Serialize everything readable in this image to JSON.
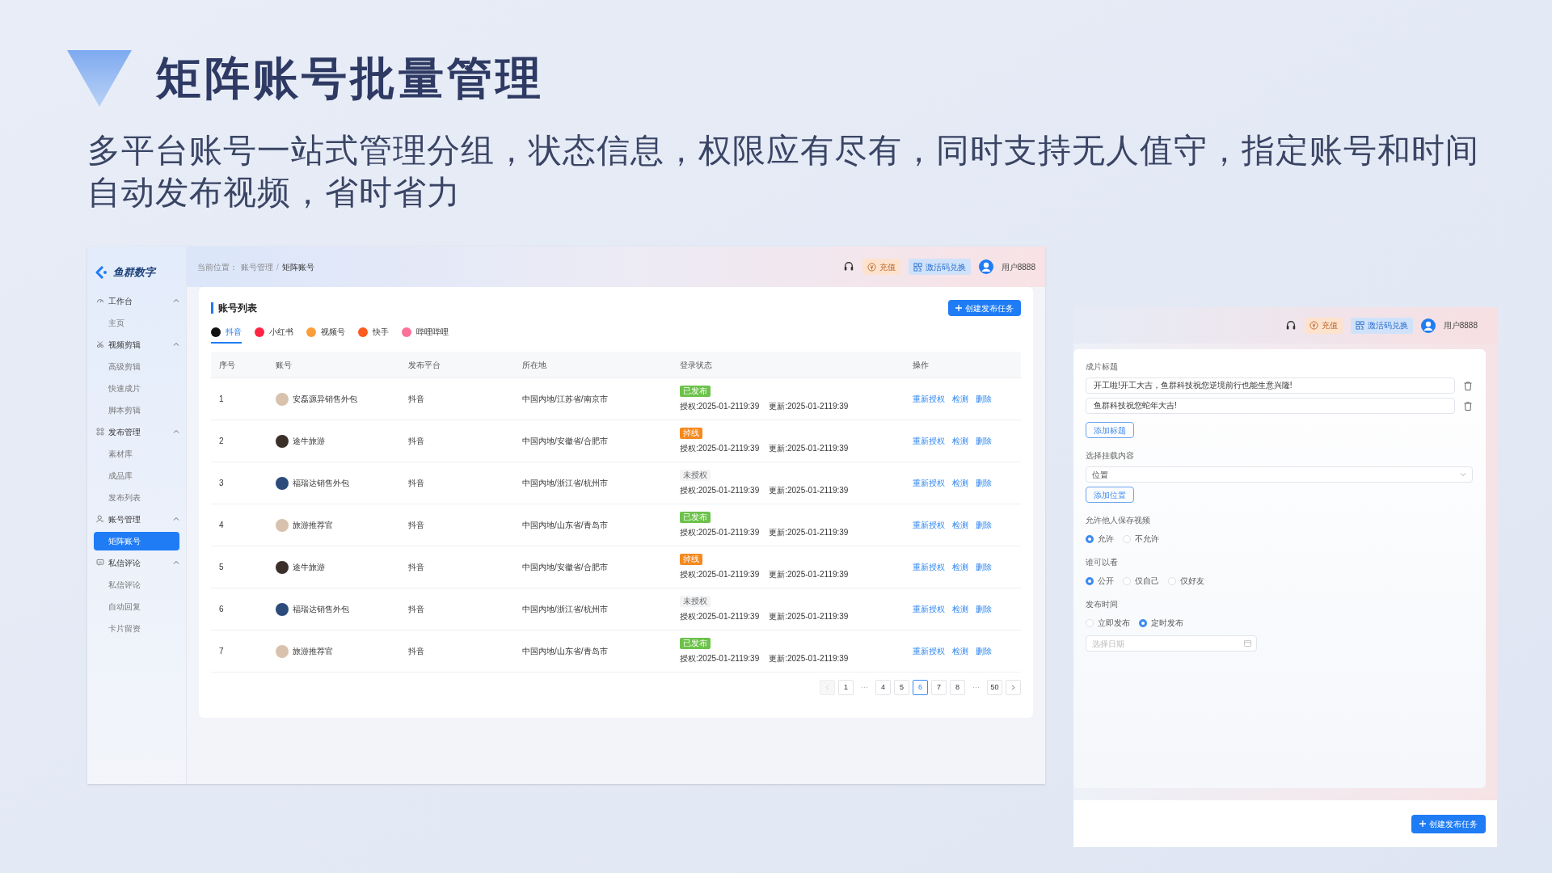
{
  "heading": {
    "title": "矩阵账号批量管理",
    "subtitle": "多平台账号一站式管理分组，状态信息，权限应有尽有，同时支持无人值守，指定账号和时间自动发布视频，省时省力"
  },
  "main_window": {
    "logo": "鱼群数字",
    "sidebar": [
      {
        "label": "工作台",
        "expanded": true,
        "children": [
          {
            "label": "主页",
            "selected": false
          }
        ]
      },
      {
        "label": "视频剪辑",
        "expanded": true,
        "children": [
          {
            "label": "高级剪辑",
            "selected": false
          },
          {
            "label": "快速成片",
            "selected": false
          },
          {
            "label": "脚本剪辑",
            "selected": false
          }
        ]
      },
      {
        "label": "发布管理",
        "expanded": true,
        "children": [
          {
            "label": "素材库",
            "selected": false
          },
          {
            "label": "成品库",
            "selected": false
          },
          {
            "label": "发布列表",
            "selected": false
          }
        ]
      },
      {
        "label": "账号管理",
        "expanded": true,
        "children": [
          {
            "label": "矩阵账号",
            "selected": true
          }
        ]
      },
      {
        "label": "私信评论",
        "expanded": true,
        "children": [
          {
            "label": "私信评论",
            "selected": false
          },
          {
            "label": "自动回复",
            "selected": false
          },
          {
            "label": "卡片留资",
            "selected": false
          }
        ]
      }
    ],
    "breadcrumb": {
      "prefix": "当前位置：",
      "items": [
        "账号管理",
        "矩阵账号"
      ],
      "separator": "/"
    },
    "header": {
      "recharge": "充值",
      "redeem": "激活码兑换",
      "user": "用户8888"
    },
    "card": {
      "title": "账号列表",
      "create_button": "创建发布任务",
      "tabs": [
        {
          "label": "抖音",
          "selected": true,
          "color": "#111111"
        },
        {
          "label": "小红书",
          "selected": false,
          "color": "#ff2442"
        },
        {
          "label": "视频号",
          "selected": false,
          "color": "#fa9d3b"
        },
        {
          "label": "快手",
          "selected": false,
          "color": "#ff5a1f"
        },
        {
          "label": "哔哩哔哩",
          "selected": false,
          "color": "#fb7299"
        }
      ],
      "table": {
        "columns": [
          "序号",
          "账号",
          "发布平台",
          "所在地",
          "登录状态",
          "操作"
        ],
        "rows": [
          {
            "index": "1",
            "account": "安磊源异销售外包",
            "platform": "抖音",
            "location": "中国内地/江苏省/南京市",
            "status": {
              "kind": "published",
              "label": "已发布"
            },
            "authorized": "授权:2025-01-2119:39",
            "updated": "更新:2025-01-2119:39",
            "actions": [
              "重新授权",
              "检测",
              "删除"
            ]
          },
          {
            "index": "2",
            "account": "途牛旅游",
            "platform": "抖音",
            "location": "中国内地/安徽省/合肥市",
            "status": {
              "kind": "offline",
              "label": "掉线"
            },
            "authorized": "授权:2025-01-2119:39",
            "updated": "更新:2025-01-2119:39",
            "actions": [
              "重新授权",
              "检测",
              "删除"
            ]
          },
          {
            "index": "3",
            "account": "福瑞达销售外包",
            "platform": "抖音",
            "location": "中国内地/浙江省/杭州市",
            "status": {
              "kind": "unauthorized",
              "label": "未授权"
            },
            "authorized": "授权:2025-01-2119:39",
            "updated": "更新:2025-01-2119:39",
            "actions": [
              "重新授权",
              "检测",
              "删除"
            ]
          },
          {
            "index": "4",
            "account": "旅游推荐官",
            "platform": "抖音",
            "location": "中国内地/山东省/青岛市",
            "status": {
              "kind": "published",
              "label": "已发布"
            },
            "authorized": "授权:2025-01-2119:39",
            "updated": "更新:2025-01-2119:39",
            "actions": [
              "重新授权",
              "检测",
              "删除"
            ]
          },
          {
            "index": "5",
            "account": "途牛旅游",
            "platform": "抖音",
            "location": "中国内地/安徽省/合肥市",
            "status": {
              "kind": "offline",
              "label": "掉线"
            },
            "authorized": "授权:2025-01-2119:39",
            "updated": "更新:2025-01-2119:39",
            "actions": [
              "重新授权",
              "检测",
              "删除"
            ]
          },
          {
            "index": "6",
            "account": "福瑞达销售外包",
            "platform": "抖音",
            "location": "中国内地/浙江省/杭州市",
            "status": {
              "kind": "unauthorized",
              "label": "未授权"
            },
            "authorized": "授权:2025-01-2119:39",
            "updated": "更新:2025-01-2119:39",
            "actions": [
              "重新授权",
              "检测",
              "删除"
            ]
          },
          {
            "index": "7",
            "account": "旅游推荐官",
            "platform": "抖音",
            "location": "中国内地/山东省/青岛市",
            "status": {
              "kind": "published",
              "label": "已发布"
            },
            "authorized": "授权:2025-01-2119:39",
            "updated": "更新:2025-01-2119:39",
            "actions": [
              "重新授权",
              "检测",
              "删除"
            ]
          }
        ]
      },
      "pagination": [
        {
          "kind": "prev",
          "disabled": true
        },
        {
          "kind": "page",
          "label": "1",
          "selected": false
        },
        {
          "kind": "ellipsis",
          "label": "···"
        },
        {
          "kind": "page",
          "label": "4",
          "selected": false
        },
        {
          "kind": "page",
          "label": "5",
          "selected": false
        },
        {
          "kind": "page",
          "label": "6",
          "selected": true
        },
        {
          "kind": "page",
          "label": "7",
          "selected": false
        },
        {
          "kind": "page",
          "label": "8",
          "selected": false
        },
        {
          "kind": "ellipsis",
          "label": "···"
        },
        {
          "kind": "page",
          "label": "50",
          "selected": false
        },
        {
          "kind": "next",
          "disabled": false
        }
      ]
    }
  },
  "publish_panel": {
    "header": {
      "recharge": "充值",
      "redeem": "激活码兑换",
      "user": "用户8888"
    },
    "title_label": "成片标题",
    "titles": [
      "开工啦!开工大吉，鱼群科技祝您逆境前行也能生意兴隆!",
      "鱼群科技祝您蛇年大吉!"
    ],
    "add_title": "添加标题",
    "mount_label": "选择挂载内容",
    "mount_value": "位置",
    "add_location": "添加位置",
    "radio_groups": [
      {
        "label": "允许他人保存视频",
        "options": [
          {
            "label": "允许",
            "selected": true
          },
          {
            "label": "不允许",
            "selected": false
          }
        ]
      },
      {
        "label": "谁可以看",
        "options": [
          {
            "label": "公开",
            "selected": true
          },
          {
            "label": "仅自己",
            "selected": false
          },
          {
            "label": "仅好友",
            "selected": false
          }
        ]
      },
      {
        "label": "发布时间",
        "options": [
          {
            "label": "立即发布",
            "selected": false
          },
          {
            "label": "定时发布",
            "selected": true
          }
        ]
      }
    ],
    "date_placeholder": "选择日期",
    "create_button": "创建发布任务"
  }
}
